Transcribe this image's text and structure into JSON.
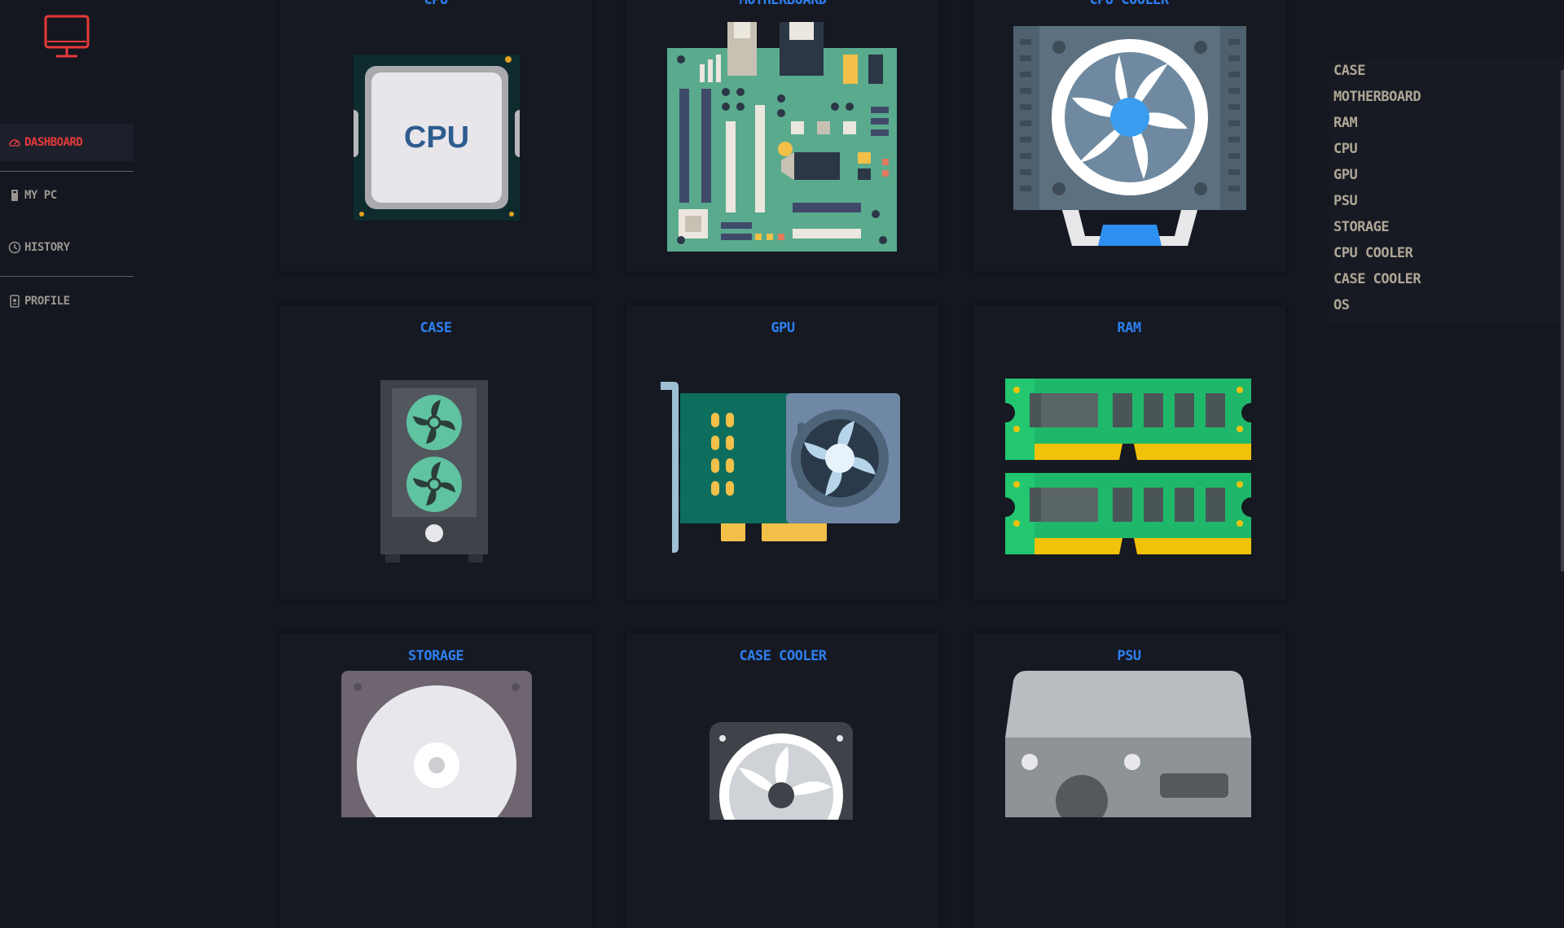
{
  "colors": {
    "background": "#14171f",
    "card": "#161921",
    "accent_blue": "#2d7ff0",
    "active_red": "#e53a3a",
    "nav_text": "#9a9590",
    "list_text": "#aea696"
  },
  "sidebar": {
    "logo_icon": "monitor-icon",
    "items": [
      {
        "label": "DASHBOARD",
        "icon": "speedometer-icon",
        "active": true
      },
      {
        "label": "MY PC",
        "icon": "pc-tower-icon",
        "active": false
      },
      {
        "label": "HISTORY",
        "icon": "clock-icon",
        "active": false
      },
      {
        "label": "PROFILE",
        "icon": "badge-icon",
        "active": false
      }
    ]
  },
  "cards": [
    {
      "title": "CPU",
      "icon": "cpu-chip-icon",
      "chip_text": "CPU"
    },
    {
      "title": "MOTHERBOARD",
      "icon": "motherboard-icon"
    },
    {
      "title": "CPU COOLER",
      "icon": "cpu-cooler-icon"
    },
    {
      "title": "CASE",
      "icon": "pc-case-icon"
    },
    {
      "title": "GPU",
      "icon": "graphics-card-icon"
    },
    {
      "title": "RAM",
      "icon": "ram-module-icon"
    },
    {
      "title": "STORAGE",
      "icon": "hard-drive-icon"
    },
    {
      "title": "CASE COOLER",
      "icon": "case-fan-icon"
    },
    {
      "title": "PSU",
      "icon": "power-supply-icon"
    }
  ],
  "parts_list": [
    "CASE",
    "MOTHERBOARD",
    "RAM",
    "CPU",
    "GPU",
    "PSU",
    "STORAGE",
    "CPU COOLER",
    "CASE COOLER",
    "OS"
  ]
}
